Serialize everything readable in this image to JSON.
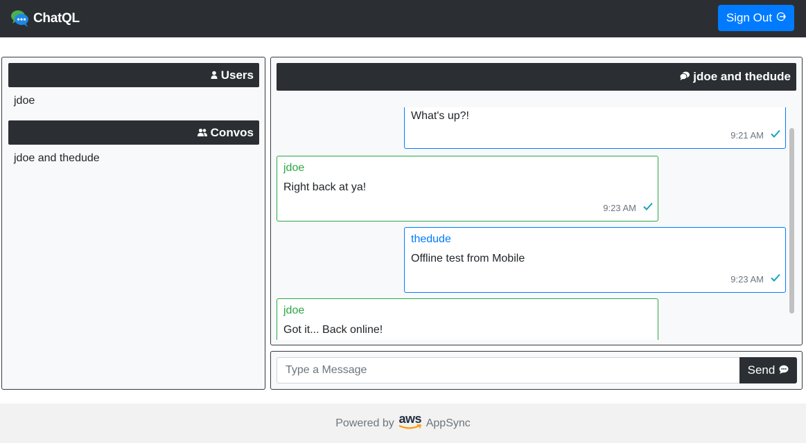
{
  "navbar": {
    "brand": "ChatQL",
    "signout_label": "Sign Out",
    "colors": {
      "bg": "#2b2f33",
      "signout_bg": "#007bff"
    }
  },
  "sidebar": {
    "users_header": "Users",
    "users": [
      "jdoe"
    ],
    "convos_header": "Convos",
    "convos": [
      "jdoe and thedude"
    ]
  },
  "chat": {
    "title": "jdoe and thedude",
    "messages": [
      {
        "author": "",
        "text": "What's up?!",
        "time": "9:21 AM",
        "mine": true
      },
      {
        "author": "jdoe",
        "text": "Right back at ya!",
        "time": "9:23 AM",
        "mine": false
      },
      {
        "author": "thedude",
        "text": "Offline test from Mobile",
        "time": "9:23 AM",
        "mine": true
      },
      {
        "author": "jdoe",
        "text": "Got it... Back online!",
        "time": "",
        "mine": false
      }
    ],
    "colors": {
      "mine_border": "#007bff",
      "theirs_border": "#28a745",
      "check": "#17a2b8"
    }
  },
  "composer": {
    "placeholder": "Type a Message",
    "send_label": "Send"
  },
  "footer": {
    "powered_by": "Powered by",
    "aws": "aws",
    "product": "AppSync"
  }
}
